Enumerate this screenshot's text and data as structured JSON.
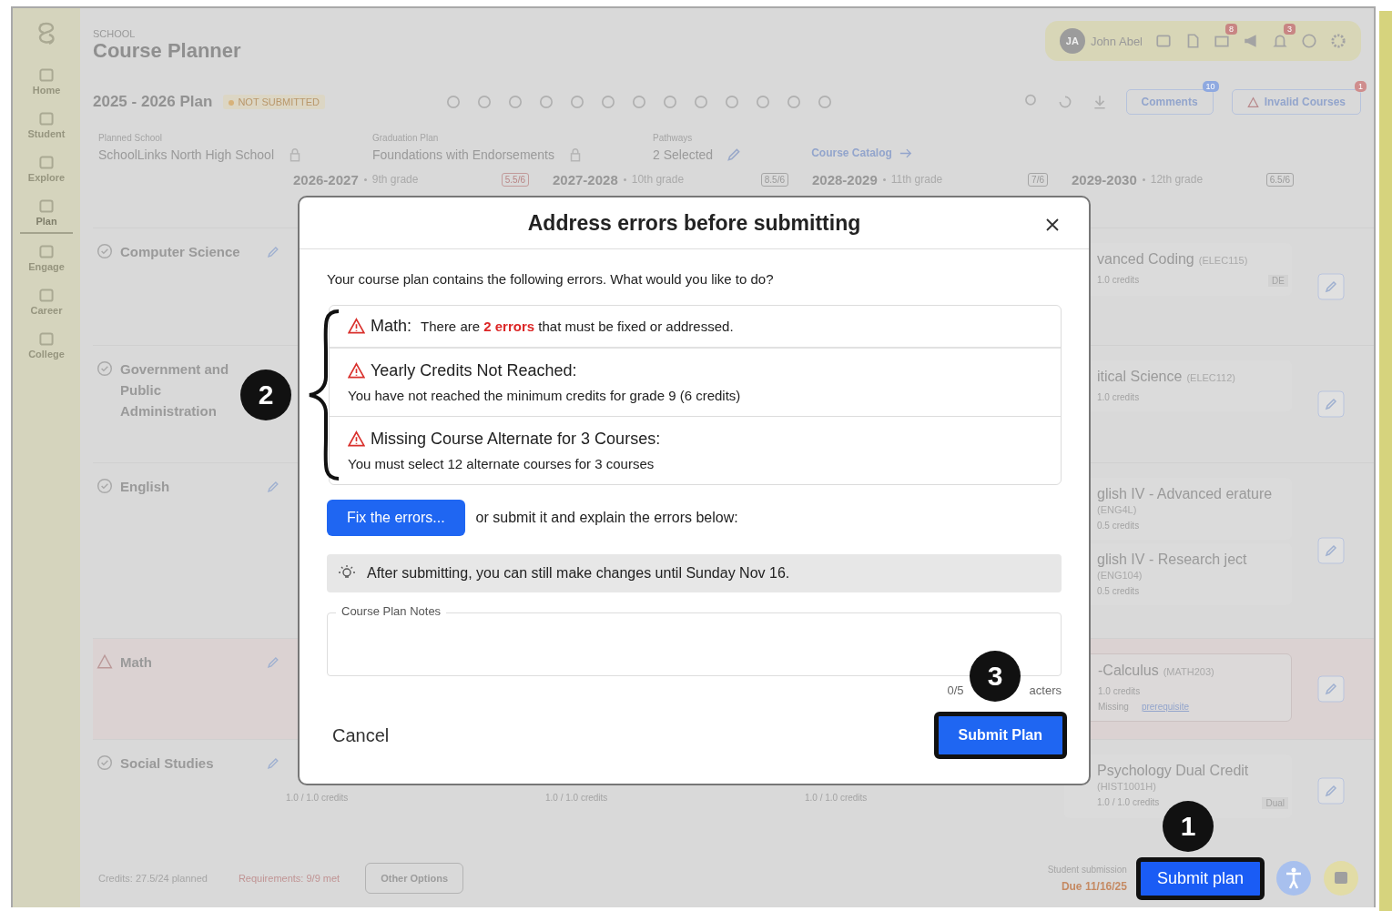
{
  "sidebar": {
    "items": [
      {
        "label": "Home",
        "selected": false
      },
      {
        "label": "Student",
        "selected": false
      },
      {
        "label": "Explore",
        "selected": false
      },
      {
        "label": "Plan",
        "selected": true
      },
      {
        "label": "Engage",
        "selected": false
      },
      {
        "label": "Career",
        "selected": false
      },
      {
        "label": "College",
        "selected": false
      }
    ]
  },
  "header": {
    "eyebrow": "SCHOOL",
    "title": "Course Planner",
    "user": {
      "initials": "JA",
      "name": "John Abel"
    },
    "message_badge": "8",
    "notification_badge": "3"
  },
  "plan": {
    "title": "2025 - 2026 Plan",
    "status": "NOT SUBMITTED",
    "comments": {
      "label": "Comments",
      "badge": "10"
    },
    "invalid": {
      "label": "Invalid Courses",
      "badge": "1"
    }
  },
  "fields": [
    {
      "label": "Planned School",
      "value": "SchoolLinks North High School",
      "kind": "locked"
    },
    {
      "label": "Graduation Plan",
      "value": "Foundations with Endorsements",
      "kind": "locked"
    },
    {
      "label": "Pathways",
      "value": "2 Selected",
      "kind": "editable"
    }
  ],
  "catalog_link": "Course Catalog",
  "years": [
    {
      "year": "2026-2027",
      "grade": "9th grade",
      "credits": "5.5/6"
    },
    {
      "year": "2027-2028",
      "grade": "10th grade",
      "credits": "8.5/6"
    },
    {
      "year": "2028-2029",
      "grade": "11th grade",
      "credits": "7/6"
    },
    {
      "year": "2029-2030",
      "grade": "12th grade",
      "credits": "6.5/6"
    }
  ],
  "subjects": [
    {
      "name": "Computer Science",
      "warning": false,
      "courses": [
        {
          "title": "vanced Coding",
          "code": "(ELEC115)",
          "credits": "1.0 credits",
          "tag": "DE"
        }
      ]
    },
    {
      "name": "Government and Public Administration",
      "warning": false,
      "pencil_hidden": true,
      "courses": [
        {
          "title": "itical Science",
          "code": "(ELEC112)",
          "credits": "1.0 credits"
        }
      ]
    },
    {
      "name": "English",
      "warning": false,
      "courses": [
        {
          "title": "glish IV - Advanced erature",
          "code": "(ENG4L)",
          "credits": "0.5 credits"
        },
        {
          "title": "glish IV - Research ject",
          "code": "(ENG104)",
          "credits": "0.5 credits"
        }
      ]
    },
    {
      "name": "Math",
      "warning": true,
      "courses": [
        {
          "title": "-Calculus",
          "code": "(MATH203)",
          "credits": "1.0 credits",
          "missing": "Missing",
          "missing_link": "prerequisite"
        }
      ]
    },
    {
      "name": "Social Studies",
      "warning": false,
      "credits": [
        "1.0 / 1.0 credits",
        "1.0 / 1.0 credits",
        "1.0 / 1.0 credits"
      ],
      "courses": [
        {
          "title": "Psychology Dual Credit",
          "code": "(HIST1001H)",
          "credits": "1.0 / 1.0 credits",
          "tag": "Dual"
        }
      ]
    }
  ],
  "footer": {
    "credits": "Credits: 27.5/24 planned",
    "requirements": "Requirements: 9/9 met",
    "other_options": "Other Options",
    "submission_label": "Student submission",
    "due": "Due 11/16/25",
    "submit": "Submit plan"
  },
  "modal": {
    "title": "Address errors before submitting",
    "intro": "Your course plan contains the following errors. What would you like to do?",
    "errors": [
      {
        "kind": "inline",
        "title": "Math:",
        "detail": "There are **2 errors** that must be fixed or addressed."
      },
      {
        "kind": "block",
        "title": "Yearly Credits Not Reached:",
        "detail": "You have not reached the minimum credits for grade 9 (6 credits)"
      },
      {
        "kind": "block",
        "title": "Missing Course Alternate for 3 Courses:",
        "detail": "You must select 12 alternate courses for 3 courses"
      }
    ],
    "fix_button": "Fix the errors...",
    "or_text": "or submit it and explain the errors below:",
    "info": "After submitting, you can still make changes until Sunday Nov 16.",
    "notes_label": "Course Plan Notes",
    "counter_start": "0/5",
    "counter_end": "acters",
    "cancel": "Cancel",
    "submit": "Submit Plan"
  },
  "callouts": [
    "1",
    "2",
    "3"
  ]
}
